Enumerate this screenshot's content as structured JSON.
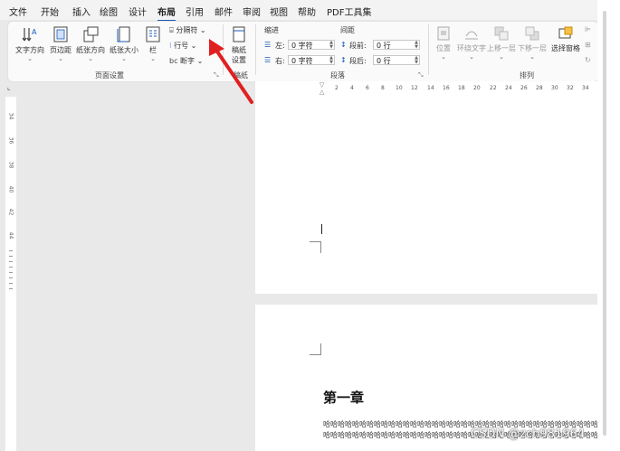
{
  "menu": [
    "文件",
    "开始",
    "插入",
    "绘图",
    "设计",
    "布局",
    "引用",
    "邮件",
    "审阅",
    "视图",
    "帮助",
    "PDF工具集"
  ],
  "active_tab": "布局",
  "page_setup": {
    "text_direction": "文字方向",
    "margins": "页边距",
    "orientation": "纸张方向",
    "size": "纸张大小",
    "columns": "栏",
    "breaks": "分隔符",
    "line_numbers": "行号",
    "hyphenation": "断字",
    "group_label": "页面设置"
  },
  "manuscript": {
    "label_1": "稿纸",
    "label_2": "设置",
    "group_label": "稿纸"
  },
  "paragraph": {
    "indent_header": "缩进",
    "spacing_header": "间距",
    "left_label": "左:",
    "left_value": "0 字符",
    "right_label": "右:",
    "right_value": "0 字符",
    "before_label": "段前:",
    "before_value": "0 行",
    "after_label": "段后:",
    "after_value": "0 行",
    "group_label": "段落"
  },
  "arrange": {
    "position": "位置",
    "wrap_text": "环绕文字",
    "bring_forward": "上移一层",
    "send_backward": "下移一层",
    "selection_pane": "选择窗格",
    "group_label": "排列"
  },
  "ruler_numbers": [
    "2",
    "4",
    "6",
    "8",
    "10",
    "12",
    "14",
    "16",
    "18",
    "20",
    "22",
    "24",
    "26",
    "28",
    "30",
    "32",
    "34"
  ],
  "vertical_ruler": [
    "34",
    "36",
    "38",
    "40",
    "42",
    "44"
  ],
  "document": {
    "chapter_title": "第一章",
    "body_line_1": "哈哈哈哈哈哈哈哈哈哈哈哈哈哈哈哈哈哈哈哈哈哈哈哈哈哈哈哈哈哈哈哈哈哈哈哈哈哈",
    "body_line_2": "哈哈哈哈哈哈哈哈哈哈哈哈哈哈哈哈哈哈哈哈哈哈哈哈哈哈哈哈哈哈哈哈哈哈哈哈哈哈"
  },
  "watermark": "CSDN @zch981964",
  "colors": {
    "accent": "#185abd",
    "arrow": "#e02020"
  }
}
